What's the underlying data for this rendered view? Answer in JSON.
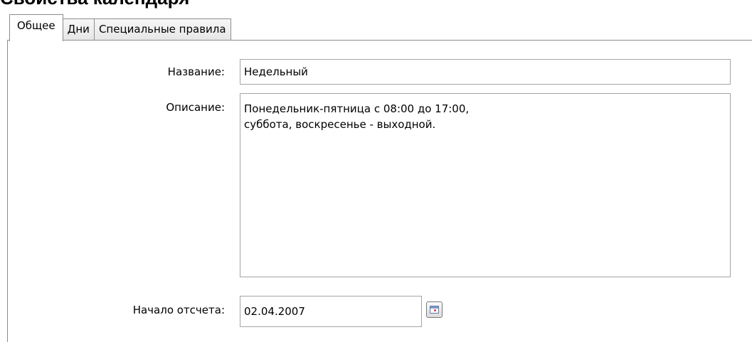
{
  "window": {
    "heading": "Свойства календаря"
  },
  "tabs": [
    {
      "label": "Общее"
    },
    {
      "label": "Дни"
    },
    {
      "label": "Специальные правила"
    }
  ],
  "form": {
    "name_label": "Название:",
    "name_value": "Недельный",
    "description_label": "Описание:",
    "description_value": "Понедельник-пятница с 08:00 до 17:00,\nсуббота, воскресенье - выходной.",
    "start_label": "Начало отсчета:",
    "start_value": "02.04.2007",
    "calendar_button_icon": "calendar-icon"
  },
  "colors": {
    "tab_border": "#8d8d8d",
    "field_border": "#a5a5a5",
    "calendar_icon_accent": "#d23b3b"
  }
}
